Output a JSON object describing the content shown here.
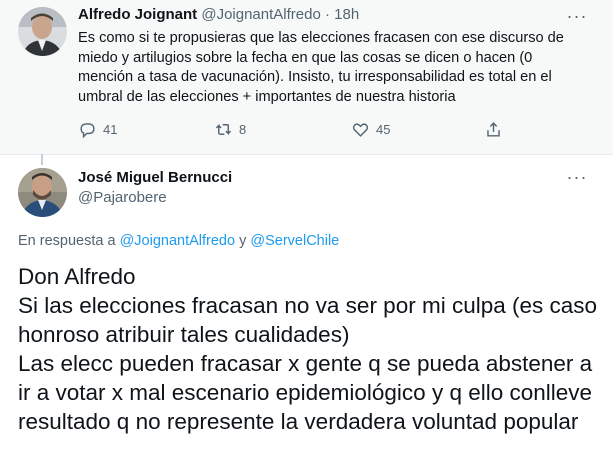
{
  "parent_tweet": {
    "name": "Alfredo Joignant",
    "handle": "@JoignantAlfredo",
    "time": "18h",
    "text": "Es como si te propusieras que las elecciones fracasen con ese discurso de miedo y artilugios sobre la fecha en que las cosas se dicen o hacen (0 mención a tasa de vacunación). Insisto, tu irresponsabilidad es total en el umbral de las elecciones + importantes de nuestra historia",
    "replies_count": "41",
    "retweets_count": "8",
    "likes_count": "45",
    "reply_icon": "comment-icon",
    "retweet_icon": "retweet-icon",
    "like_icon": "heart-icon",
    "share_icon": "share-icon"
  },
  "reply_tweet": {
    "name": "José Miguel Bernucci",
    "handle": "@Pajarobere",
    "replying_prefix": "En respuesta a",
    "replying_user1": "@JoignantAlfredo",
    "replying_joiner": "y",
    "replying_user2": "@ServelChile",
    "text": "Don Alfredo\nSi las elecciones fracasan no va ser por mi culpa (es caso honroso atribuir tales cualidades)\nLas elecc pueden fracasar x gente q se pueda abstener a ir a votar x mal escenario  epidemiológico y q ello conlleve resultado q no represente la verdadera voluntad popular"
  },
  "colors": {
    "link": "#1d9bf0",
    "muted": "#536471",
    "parent_bg": "#f7f9f9"
  }
}
